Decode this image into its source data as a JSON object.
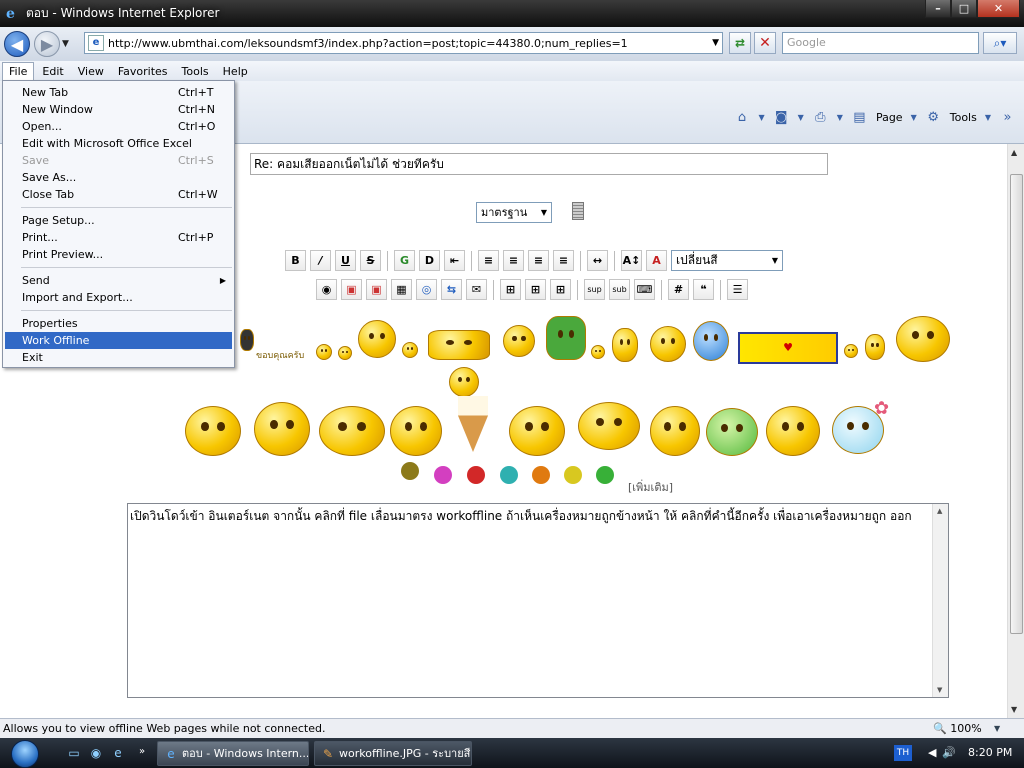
{
  "window": {
    "title": "ตอบ - Windows Internet Explorer"
  },
  "address": {
    "url": "http://www.ubmthai.com/leksoundsmf3/index.php?action=post;topic=44380.0;num_replies=1",
    "search_placeholder": "Google"
  },
  "menubar": [
    "File",
    "Edit",
    "View",
    "Favorites",
    "Tools",
    "Help"
  ],
  "file_menu": {
    "items": [
      {
        "label": "New Tab",
        "shortcut": "Ctrl+T"
      },
      {
        "label": "New Window",
        "shortcut": "Ctrl+N"
      },
      {
        "label": "Open...",
        "shortcut": "Ctrl+O"
      },
      {
        "label": "Edit with Microsoft Office Excel",
        "shortcut": ""
      },
      {
        "label": "Save",
        "shortcut": "Ctrl+S"
      },
      {
        "label": "Save As...",
        "shortcut": ""
      },
      {
        "label": "Close Tab",
        "shortcut": "Ctrl+W"
      },
      {
        "label": "Page Setup...",
        "shortcut": ""
      },
      {
        "label": "Print...",
        "shortcut": "Ctrl+P"
      },
      {
        "label": "Print Preview...",
        "shortcut": ""
      },
      {
        "label": "Send",
        "shortcut": ""
      },
      {
        "label": "Import and Export...",
        "shortcut": ""
      },
      {
        "label": "Properties",
        "shortcut": ""
      },
      {
        "label": "Work Offline",
        "shortcut": ""
      },
      {
        "label": "Exit",
        "shortcut": ""
      }
    ]
  },
  "commandbar": {
    "page_label": "Page",
    "tools_label": "Tools"
  },
  "post": {
    "subject": "Re: คอมเสียออกเน็ตไม่ได้ ช่วยทีครับ",
    "standard_select": "มาตรฐาน",
    "color_select": "เปลี่ยนสี",
    "sup_label": "sup",
    "sub_label": "sub",
    "thanks_label": "ขอบคุณครับ",
    "more_link": "[เพิ่มเติม]",
    "message": "เปิดวินโดว์เข้า อินเตอร์เนต จากนั้น คลิกที่ file เลื่อนมาตรง workoffline ถ้าเห็นเครื่องหมายถูกข้างหน้า ให้ คลิกที่คำนี้อีกครั้ง เพื่อเอาเครื่องหมายถูก ออก"
  },
  "statusbar": {
    "message": "Allows you to view offline Web pages while not connected.",
    "zoom": "100%"
  },
  "taskbar": {
    "tasks": [
      "ตอบ - Windows Intern...",
      "workoffline.JPG - ระบายสี"
    ],
    "language": "TH",
    "clock": "8:20 PM"
  },
  "colors": {
    "menu_highlight": "#3169c6",
    "taskbar": "#1b222b",
    "titlebar": "#1e1e1e"
  }
}
